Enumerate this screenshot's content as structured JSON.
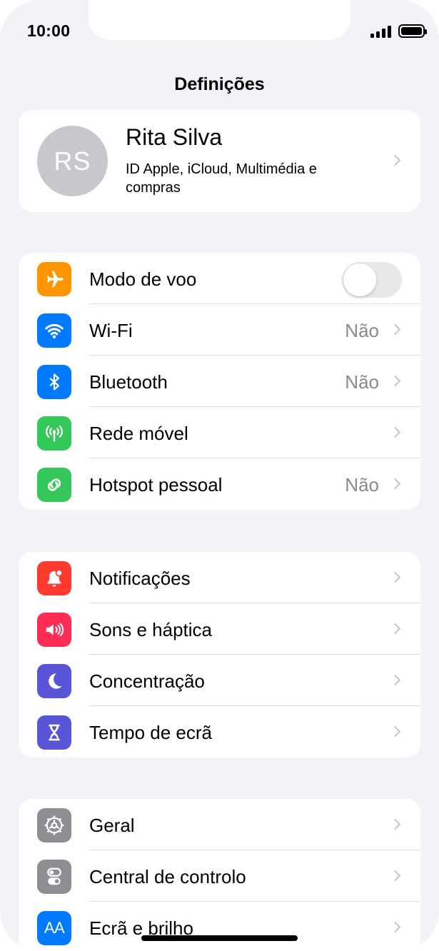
{
  "status_bar": {
    "time": "10:00"
  },
  "nav": {
    "title": "Definições"
  },
  "profile": {
    "initials": "RS",
    "name": "Rita Silva",
    "subtitle": "ID Apple, iCloud, Multimédia e compras"
  },
  "connectivity": {
    "airplane": {
      "label": "Modo de voo",
      "icon": "airplane-icon",
      "color": "#ff9500",
      "toggle_on": false
    },
    "wifi": {
      "label": "Wi-Fi",
      "value": "Não",
      "icon": "wifi-icon",
      "color": "#007aff"
    },
    "bluetooth": {
      "label": "Bluetooth",
      "value": "Não",
      "icon": "bluetooth-icon",
      "color": "#007aff"
    },
    "cellular": {
      "label": "Rede móvel",
      "icon": "antenna-icon",
      "color": "#34c759"
    },
    "hotspot": {
      "label": "Hotspot pessoal",
      "value": "Não",
      "icon": "hotspot-link-icon",
      "color": "#34c759"
    }
  },
  "attention": {
    "notifications": {
      "label": "Notificações",
      "icon": "notification-bell-icon",
      "color": "#ff3b30"
    },
    "sounds": {
      "label": "Sons e háptica",
      "icon": "speaker-icon",
      "color": "#ff2d55"
    },
    "focus": {
      "label": "Concentração",
      "icon": "moon-icon",
      "color": "#5856d6"
    },
    "screen_time": {
      "label": "Tempo de ecrã",
      "icon": "hourglass-icon",
      "color": "#5856d6"
    }
  },
  "general": {
    "general": {
      "label": "Geral",
      "icon": "gear-icon",
      "color": "#8e8e93"
    },
    "control_center": {
      "label": "Central de controlo",
      "icon": "switches-icon",
      "color": "#8e8e93"
    },
    "display": {
      "label": "Ecrã e brilho",
      "icon": "text-size-icon",
      "icon_text": "AA",
      "color": "#007aff"
    }
  }
}
